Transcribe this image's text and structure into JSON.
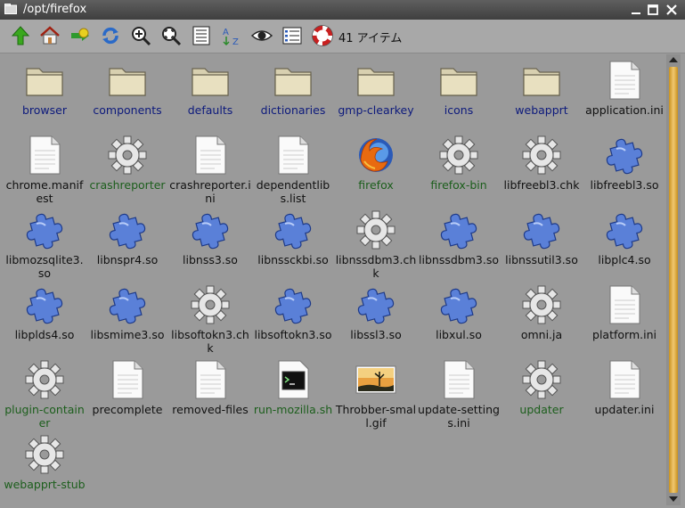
{
  "window": {
    "title": "/opt/firefox"
  },
  "toolbar": {
    "count_label": "41 アイテム"
  },
  "files": [
    {
      "name": "browser",
      "type": "dir"
    },
    {
      "name": "components",
      "type": "dir"
    },
    {
      "name": "defaults",
      "type": "dir"
    },
    {
      "name": "dictionaries",
      "type": "dir"
    },
    {
      "name": "gmp-clearkey",
      "type": "dir"
    },
    {
      "name": "icons",
      "type": "dir"
    },
    {
      "name": "webapprt",
      "type": "dir"
    },
    {
      "name": "application.ini",
      "type": "file"
    },
    {
      "name": "chrome.manifest",
      "type": "file"
    },
    {
      "name": "crashreporter",
      "type": "exe"
    },
    {
      "name": "crashreporter.ini",
      "type": "file"
    },
    {
      "name": "dependentlibs.list",
      "type": "file"
    },
    {
      "name": "firefox",
      "type": "firefox"
    },
    {
      "name": "firefox-bin",
      "type": "exe"
    },
    {
      "name": "libfreebl3.chk",
      "type": "gear"
    },
    {
      "name": "libfreebl3.so",
      "type": "lib"
    },
    {
      "name": "libmozsqlite3.so",
      "type": "lib"
    },
    {
      "name": "libnspr4.so",
      "type": "lib"
    },
    {
      "name": "libnss3.so",
      "type": "lib"
    },
    {
      "name": "libnssckbi.so",
      "type": "lib"
    },
    {
      "name": "libnssdbm3.chk",
      "type": "gear"
    },
    {
      "name": "libnssdbm3.so",
      "type": "lib"
    },
    {
      "name": "libnssutil3.so",
      "type": "lib"
    },
    {
      "name": "libplc4.so",
      "type": "lib"
    },
    {
      "name": "libplds4.so",
      "type": "lib"
    },
    {
      "name": "libsmime3.so",
      "type": "lib"
    },
    {
      "name": "libsoftokn3.chk",
      "type": "gear"
    },
    {
      "name": "libsoftokn3.so",
      "type": "lib"
    },
    {
      "name": "libssl3.so",
      "type": "lib"
    },
    {
      "name": "libxul.so",
      "type": "lib"
    },
    {
      "name": "omni.ja",
      "type": "gear"
    },
    {
      "name": "platform.ini",
      "type": "file"
    },
    {
      "name": "plugin-container",
      "type": "exe"
    },
    {
      "name": "precomplete",
      "type": "file"
    },
    {
      "name": "removed-files",
      "type": "file"
    },
    {
      "name": "run-mozilla.sh",
      "type": "script"
    },
    {
      "name": "Throbber-small.gif",
      "type": "image"
    },
    {
      "name": "update-settings.ini",
      "type": "file"
    },
    {
      "name": "updater",
      "type": "exe"
    },
    {
      "name": "updater.ini",
      "type": "file"
    },
    {
      "name": "webapprt-stub",
      "type": "exe"
    }
  ]
}
